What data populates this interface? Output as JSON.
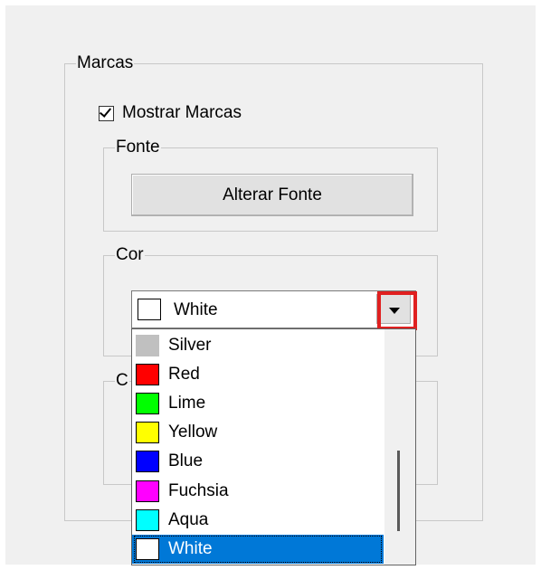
{
  "marcas_group": {
    "title": "Marcas"
  },
  "mostrar_marcas": {
    "label": "Mostrar Marcas",
    "checked": true
  },
  "fonte_group": {
    "title": "Fonte",
    "button_label": "Alterar Fonte"
  },
  "cor_group": {
    "title": "Cor",
    "selected": {
      "name": "White",
      "color": "#ffffff"
    }
  },
  "hidden_group": {
    "title_visible": "C"
  },
  "dropdown": {
    "items": [
      {
        "name": "Silver",
        "color": "#c0c0c0"
      },
      {
        "name": "Red",
        "color": "#ff0000"
      },
      {
        "name": "Lime",
        "color": "#00ff00"
      },
      {
        "name": "Yellow",
        "color": "#ffff00"
      },
      {
        "name": "Blue",
        "color": "#0000ff"
      },
      {
        "name": "Fuchsia",
        "color": "#ff00ff"
      },
      {
        "name": "Aqua",
        "color": "#00ffff"
      },
      {
        "name": "White",
        "color": "#ffffff"
      }
    ],
    "selected_index": 7
  },
  "colors": {
    "highlight": "#e02020",
    "selection": "#0078d7"
  }
}
